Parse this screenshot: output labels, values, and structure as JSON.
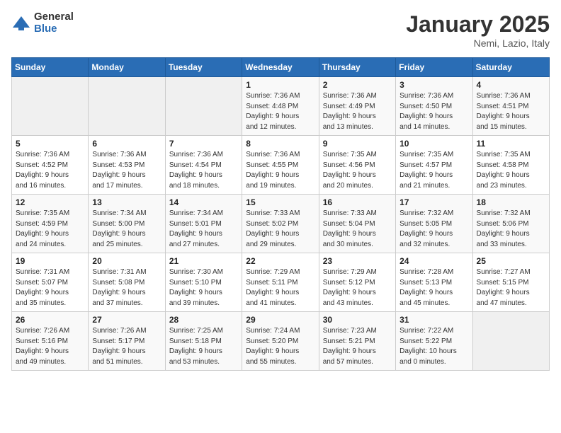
{
  "logo": {
    "general": "General",
    "blue": "Blue"
  },
  "title": "January 2025",
  "subtitle": "Nemi, Lazio, Italy",
  "weekdays": [
    "Sunday",
    "Monday",
    "Tuesday",
    "Wednesday",
    "Thursday",
    "Friday",
    "Saturday"
  ],
  "weeks": [
    [
      {
        "day": "",
        "info": ""
      },
      {
        "day": "",
        "info": ""
      },
      {
        "day": "",
        "info": ""
      },
      {
        "day": "1",
        "info": "Sunrise: 7:36 AM\nSunset: 4:48 PM\nDaylight: 9 hours\nand 12 minutes."
      },
      {
        "day": "2",
        "info": "Sunrise: 7:36 AM\nSunset: 4:49 PM\nDaylight: 9 hours\nand 13 minutes."
      },
      {
        "day": "3",
        "info": "Sunrise: 7:36 AM\nSunset: 4:50 PM\nDaylight: 9 hours\nand 14 minutes."
      },
      {
        "day": "4",
        "info": "Sunrise: 7:36 AM\nSunset: 4:51 PM\nDaylight: 9 hours\nand 15 minutes."
      }
    ],
    [
      {
        "day": "5",
        "info": "Sunrise: 7:36 AM\nSunset: 4:52 PM\nDaylight: 9 hours\nand 16 minutes."
      },
      {
        "day": "6",
        "info": "Sunrise: 7:36 AM\nSunset: 4:53 PM\nDaylight: 9 hours\nand 17 minutes."
      },
      {
        "day": "7",
        "info": "Sunrise: 7:36 AM\nSunset: 4:54 PM\nDaylight: 9 hours\nand 18 minutes."
      },
      {
        "day": "8",
        "info": "Sunrise: 7:36 AM\nSunset: 4:55 PM\nDaylight: 9 hours\nand 19 minutes."
      },
      {
        "day": "9",
        "info": "Sunrise: 7:35 AM\nSunset: 4:56 PM\nDaylight: 9 hours\nand 20 minutes."
      },
      {
        "day": "10",
        "info": "Sunrise: 7:35 AM\nSunset: 4:57 PM\nDaylight: 9 hours\nand 21 minutes."
      },
      {
        "day": "11",
        "info": "Sunrise: 7:35 AM\nSunset: 4:58 PM\nDaylight: 9 hours\nand 23 minutes."
      }
    ],
    [
      {
        "day": "12",
        "info": "Sunrise: 7:35 AM\nSunset: 4:59 PM\nDaylight: 9 hours\nand 24 minutes."
      },
      {
        "day": "13",
        "info": "Sunrise: 7:34 AM\nSunset: 5:00 PM\nDaylight: 9 hours\nand 25 minutes."
      },
      {
        "day": "14",
        "info": "Sunrise: 7:34 AM\nSunset: 5:01 PM\nDaylight: 9 hours\nand 27 minutes."
      },
      {
        "day": "15",
        "info": "Sunrise: 7:33 AM\nSunset: 5:02 PM\nDaylight: 9 hours\nand 29 minutes."
      },
      {
        "day": "16",
        "info": "Sunrise: 7:33 AM\nSunset: 5:04 PM\nDaylight: 9 hours\nand 30 minutes."
      },
      {
        "day": "17",
        "info": "Sunrise: 7:32 AM\nSunset: 5:05 PM\nDaylight: 9 hours\nand 32 minutes."
      },
      {
        "day": "18",
        "info": "Sunrise: 7:32 AM\nSunset: 5:06 PM\nDaylight: 9 hours\nand 33 minutes."
      }
    ],
    [
      {
        "day": "19",
        "info": "Sunrise: 7:31 AM\nSunset: 5:07 PM\nDaylight: 9 hours\nand 35 minutes."
      },
      {
        "day": "20",
        "info": "Sunrise: 7:31 AM\nSunset: 5:08 PM\nDaylight: 9 hours\nand 37 minutes."
      },
      {
        "day": "21",
        "info": "Sunrise: 7:30 AM\nSunset: 5:10 PM\nDaylight: 9 hours\nand 39 minutes."
      },
      {
        "day": "22",
        "info": "Sunrise: 7:29 AM\nSunset: 5:11 PM\nDaylight: 9 hours\nand 41 minutes."
      },
      {
        "day": "23",
        "info": "Sunrise: 7:29 AM\nSunset: 5:12 PM\nDaylight: 9 hours\nand 43 minutes."
      },
      {
        "day": "24",
        "info": "Sunrise: 7:28 AM\nSunset: 5:13 PM\nDaylight: 9 hours\nand 45 minutes."
      },
      {
        "day": "25",
        "info": "Sunrise: 7:27 AM\nSunset: 5:15 PM\nDaylight: 9 hours\nand 47 minutes."
      }
    ],
    [
      {
        "day": "26",
        "info": "Sunrise: 7:26 AM\nSunset: 5:16 PM\nDaylight: 9 hours\nand 49 minutes."
      },
      {
        "day": "27",
        "info": "Sunrise: 7:26 AM\nSunset: 5:17 PM\nDaylight: 9 hours\nand 51 minutes."
      },
      {
        "day": "28",
        "info": "Sunrise: 7:25 AM\nSunset: 5:18 PM\nDaylight: 9 hours\nand 53 minutes."
      },
      {
        "day": "29",
        "info": "Sunrise: 7:24 AM\nSunset: 5:20 PM\nDaylight: 9 hours\nand 55 minutes."
      },
      {
        "day": "30",
        "info": "Sunrise: 7:23 AM\nSunset: 5:21 PM\nDaylight: 9 hours\nand 57 minutes."
      },
      {
        "day": "31",
        "info": "Sunrise: 7:22 AM\nSunset: 5:22 PM\nDaylight: 10 hours\nand 0 minutes."
      },
      {
        "day": "",
        "info": ""
      }
    ]
  ]
}
